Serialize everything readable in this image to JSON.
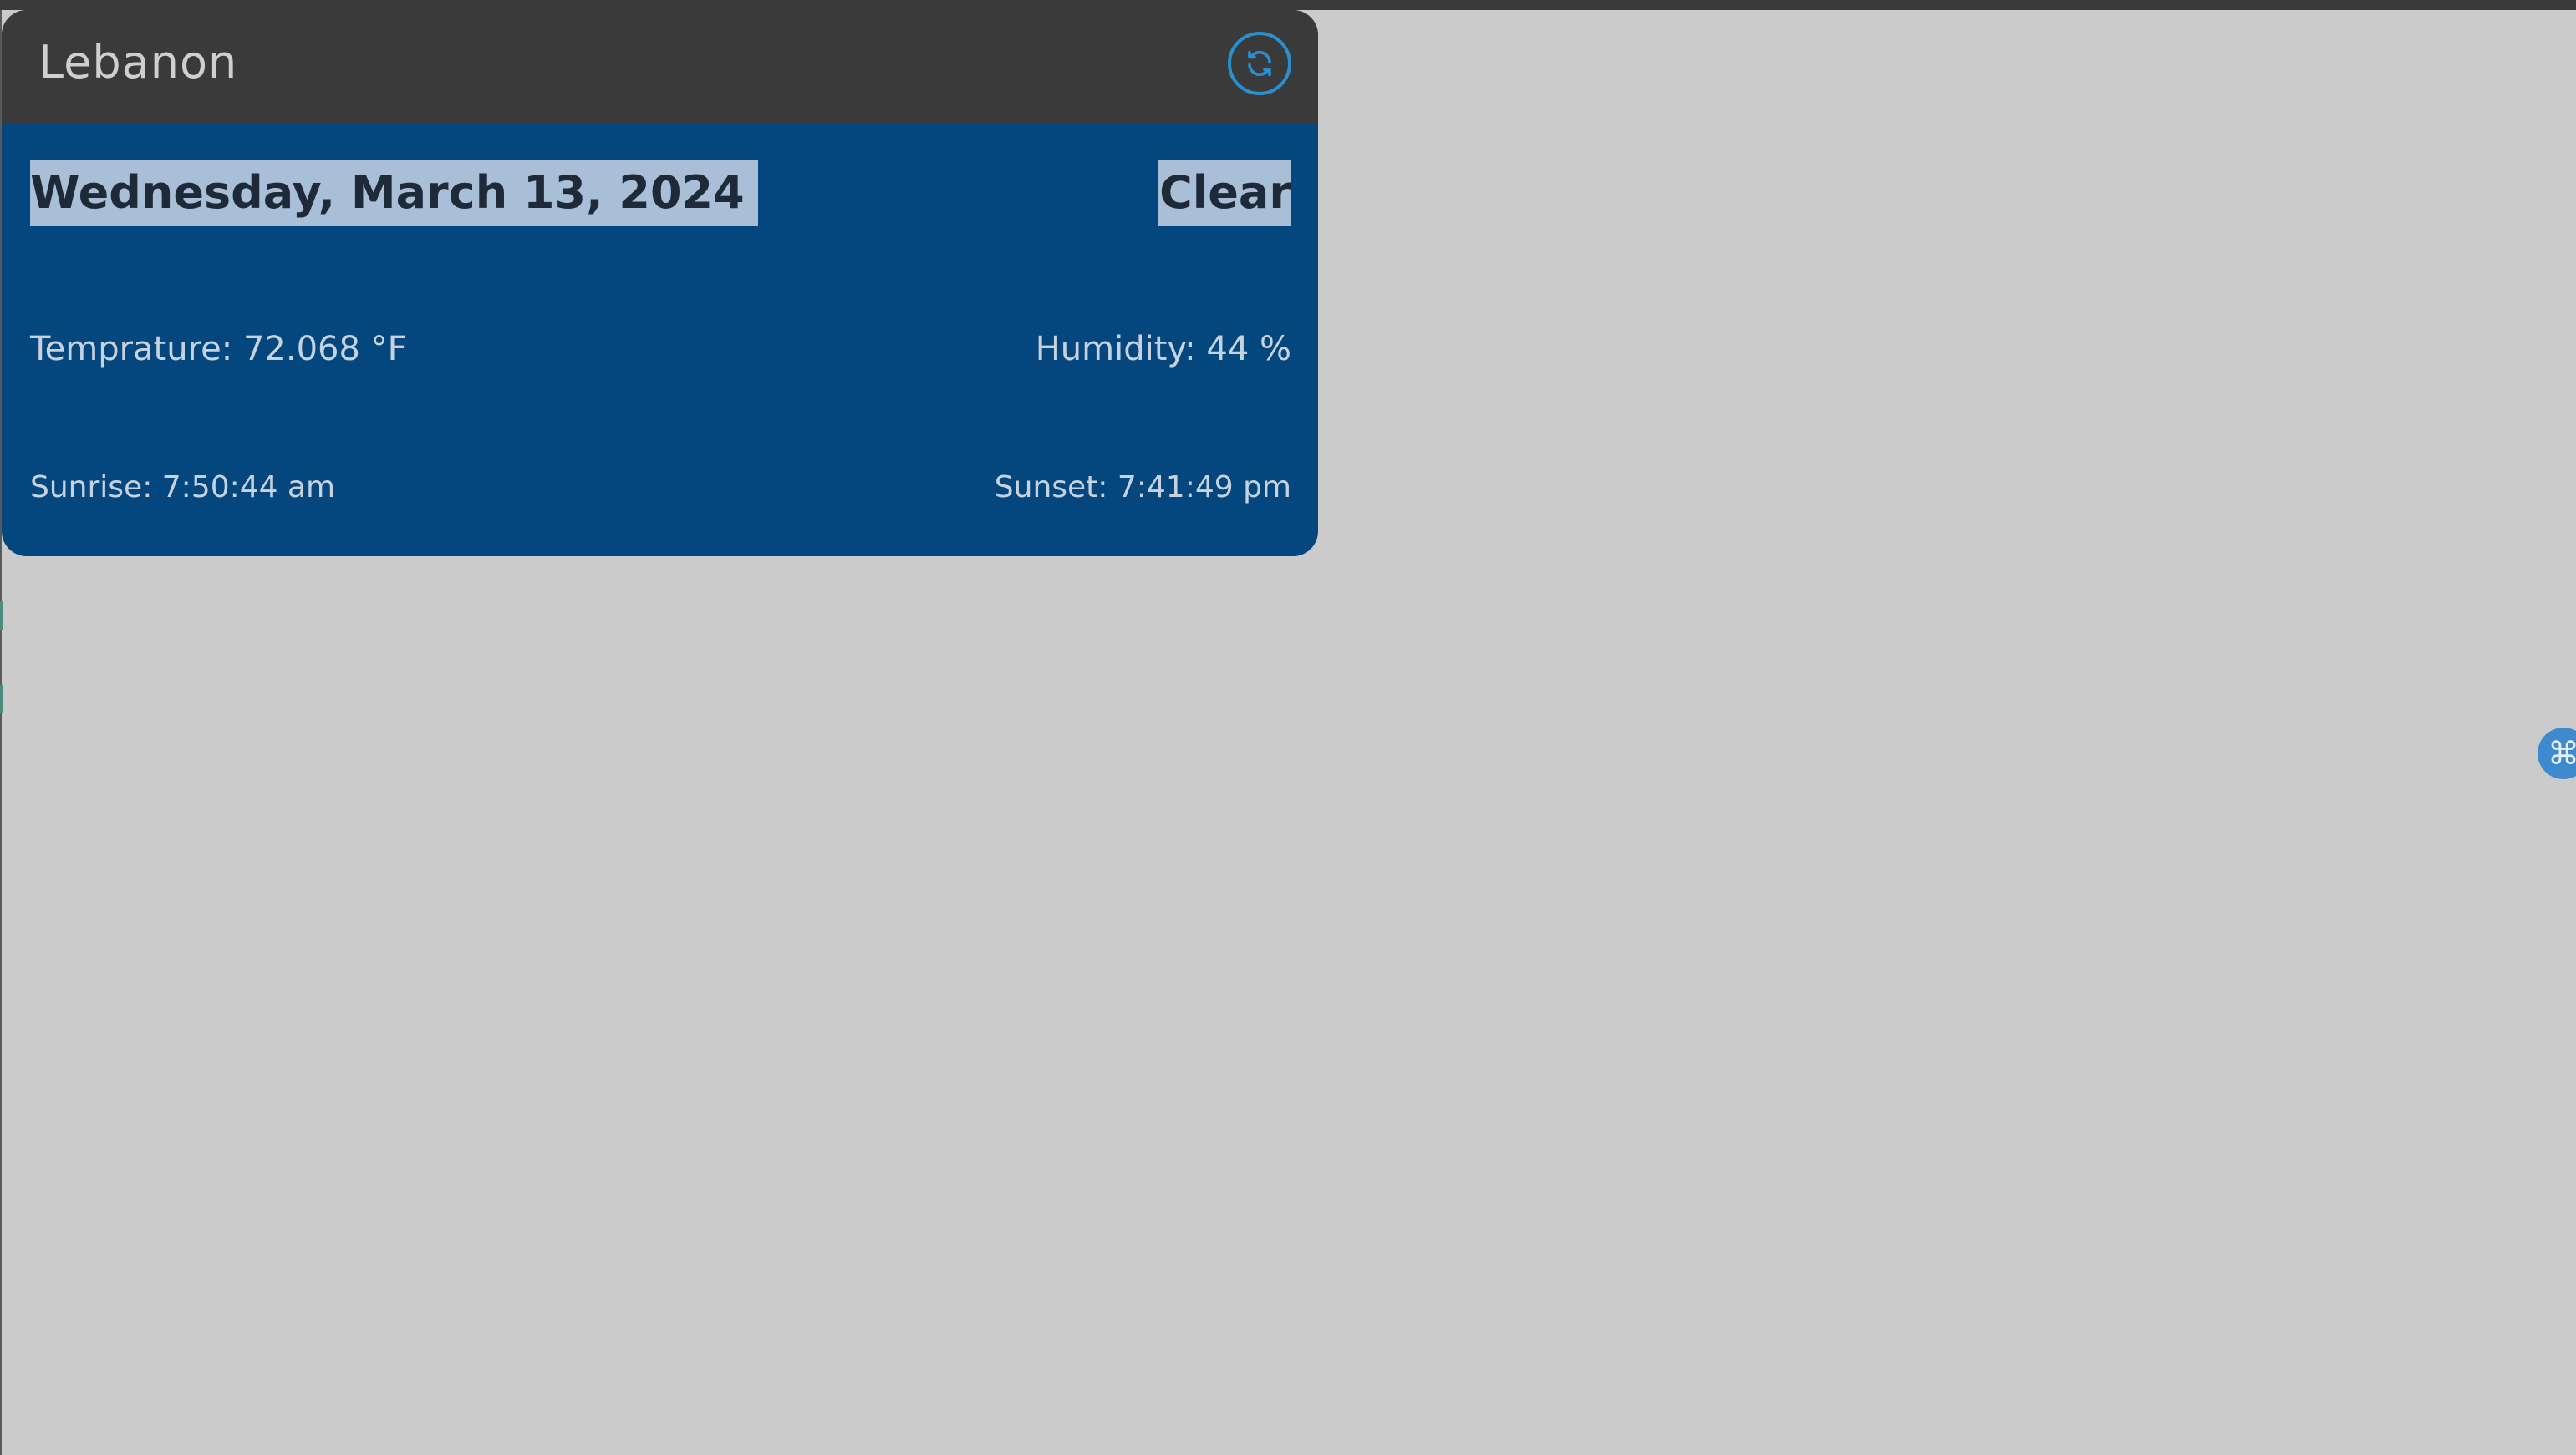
{
  "weather_card": {
    "city": "Lebanon",
    "date": "Wednesday, March 13, 2024",
    "condition": "Clear",
    "temperature": "Temprature: 72.068 °F",
    "humidity": "Humidity: 44 %",
    "sunrise": "Sunrise: 7:50:44 am",
    "sunset": "Sunset: 7:41:49 pm",
    "refresh_icon": "refresh-icon"
  },
  "floating_action": {
    "icon": "command-icon",
    "glyph": "⌘"
  },
  "colors": {
    "card_bg": "#04467e",
    "header_bg": "#3a3a3a",
    "page_bg": "#cbcbcb",
    "accent": "#2a8fd0",
    "highlight": "#a9bfd8"
  }
}
